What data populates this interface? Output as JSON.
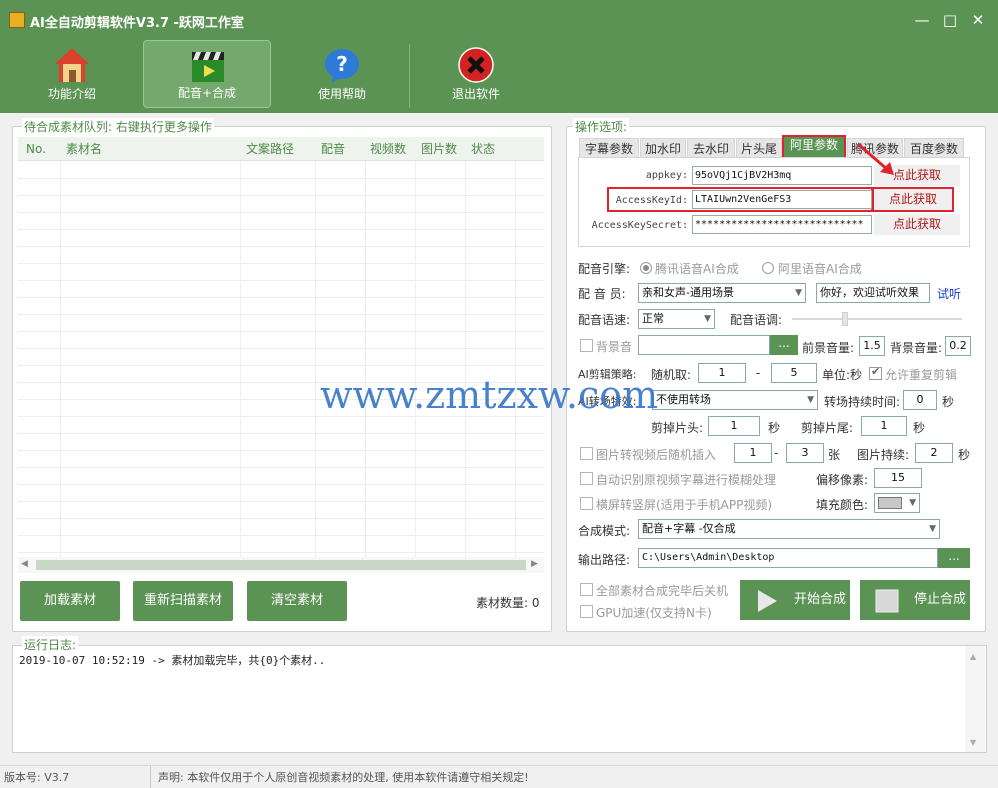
{
  "window": {
    "title": "AI全自动剪辑软件V3.7 -跃网工作室"
  },
  "toolbar": {
    "items": [
      {
        "label": "功能介绍",
        "icon": "home-icon"
      },
      {
        "label": "配音+合成",
        "icon": "clapperboard-icon",
        "active": true
      },
      {
        "label": "使用帮助",
        "icon": "help-icon"
      },
      {
        "label": "退出软件",
        "icon": "close-circle-icon"
      }
    ]
  },
  "queue": {
    "group_label": "待合成素材队列: 右键执行更多操作",
    "columns": [
      "No.",
      "素材名",
      "文案路径",
      "配音",
      "视频数",
      "图片数",
      "状态"
    ],
    "buttons": {
      "load": "加载素材",
      "rescan": "重新扫描素材",
      "clear": "清空素材"
    },
    "count_label": "素材数量: 0"
  },
  "options": {
    "group_label": "操作选项:",
    "tabs": [
      "字幕参数",
      "加水印",
      "去水印",
      "片头尾",
      "阿里参数",
      "腾讯参数",
      "百度参数"
    ],
    "active_tab": "阿里参数",
    "aliyun": {
      "appkey_label": "appkey:",
      "appkey_value": "95oVQj1CjBV2H3mq",
      "keyid_label": "AccessKeyId:",
      "keyid_value": "LTAIUwn2VenGeFS3",
      "secret_label": "AccessKeySecret:",
      "secret_value": "****************************",
      "get_link": "点此获取"
    },
    "engine": {
      "label": "配音引擎:",
      "option1": "腾讯语音AI合成",
      "option2": "阿里语音AI合成",
      "selected": "腾讯语音AI合成"
    },
    "voice": {
      "label": "配 音 员:",
      "value": "亲和女声-通用场景",
      "sample_text": "你好，欢迎试听效果",
      "test_link": "试听"
    },
    "speed": {
      "label": "配音语速:",
      "value": "正常",
      "pitch_label": "配音语调:"
    },
    "bgm": {
      "label": "背景音",
      "browse": "...",
      "front_volume_label": "前景音量:",
      "front_volume": "1.5",
      "bg_volume_label": "背景音量:",
      "bg_volume": "0.2"
    },
    "strategy": {
      "label": "AI剪辑策略:",
      "random_label": "随机取:",
      "from": "1",
      "dash": "-",
      "to": "5",
      "unit": "单位:秒",
      "allow_repeat": "允许重复剪辑"
    },
    "transition": {
      "label": "AI转场特效:",
      "value": "不使用转场",
      "duration_label": "转场持续时间:",
      "duration": "0",
      "unit": "秒"
    },
    "trim": {
      "head_label": "剪掉片头:",
      "head": "1",
      "head_unit": "秒",
      "tail_label": "剪掉片尾:",
      "tail": "1",
      "tail_unit": "秒"
    },
    "image_insert": {
      "label": "图片转视频后随机插入",
      "from": "1",
      "dash": "-",
      "to": "3",
      "unit": "张",
      "duration_label": "图片持续:",
      "duration": "2",
      "duration_unit": "秒"
    },
    "blur": {
      "label": "自动识别原视频字幕进行模糊处理",
      "offset_label": "偏移像素:",
      "offset": "15"
    },
    "portrait": {
      "label": "横屏转竖屏(适用于手机APP视频)",
      "fill_label": "填充颜色:"
    },
    "mode": {
      "label": "合成模式:",
      "value": "配音+字幕 -仅合成"
    },
    "output": {
      "label": "输出路径:",
      "value": "C:\\Users\\Admin\\Desktop",
      "browse": "..."
    },
    "shutdown": "全部素材合成完毕后关机",
    "gpu": "GPU加速(仅支持N卡)",
    "start": "开始合成",
    "stop": "停止合成"
  },
  "log": {
    "label": "运行日志:",
    "lines": [
      "2019-10-07 10:52:19 -> 素材加载完毕，共{0}个素材.."
    ]
  },
  "status": {
    "version": "版本号: V3.7",
    "notice": "声明: 本软件仅用于个人原创音视频素材的处理, 使用本软件请遵守相关规定!"
  },
  "watermark": "www.zmtzxw.com",
  "colors": {
    "accent": "#5b9354",
    "highlight": "#e0242e"
  }
}
